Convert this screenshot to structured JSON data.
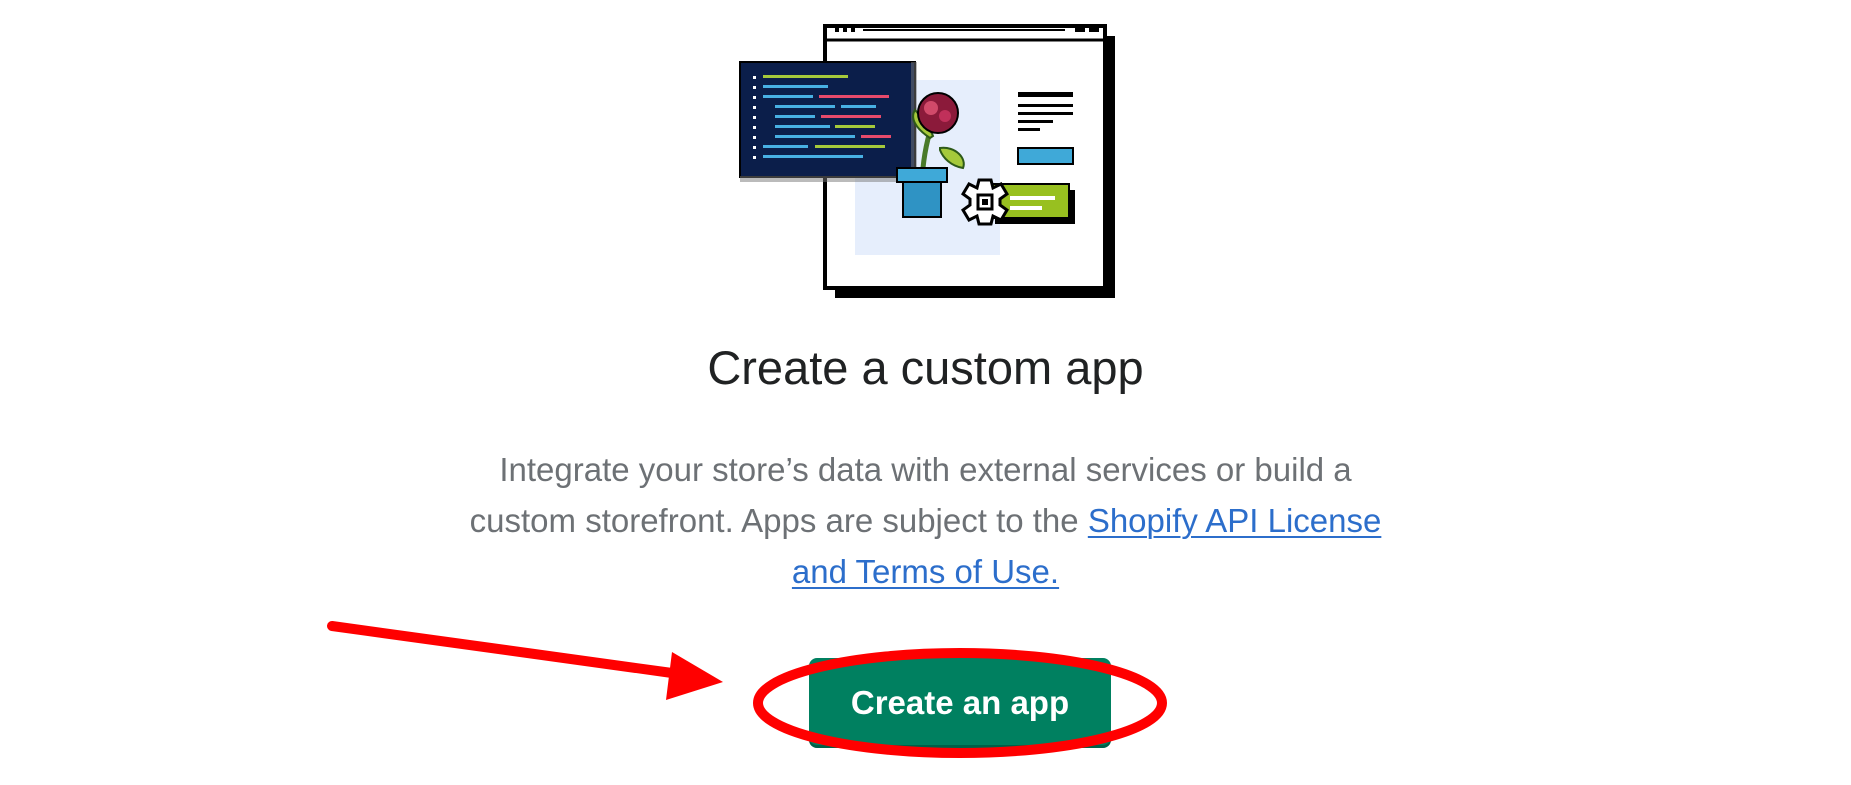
{
  "illustration": {
    "icon": "custom-app-illustration-icon"
  },
  "page": {
    "title": "Create a custom app",
    "description_text": "Integrate your store’s data with external services or build a custom storefront. Apps are subject to the ",
    "link_text": "Shopify API License and Terms of Use."
  },
  "actions": {
    "create_button_label": "Create an app"
  },
  "annotation": {
    "color": "#ff0000",
    "shapes": [
      "arrow-icon",
      "highlight-ellipse"
    ]
  },
  "colors": {
    "primary_button": "#008060",
    "link": "#2c6ecb",
    "title_text": "#202223",
    "body_text": "#6d7175"
  }
}
